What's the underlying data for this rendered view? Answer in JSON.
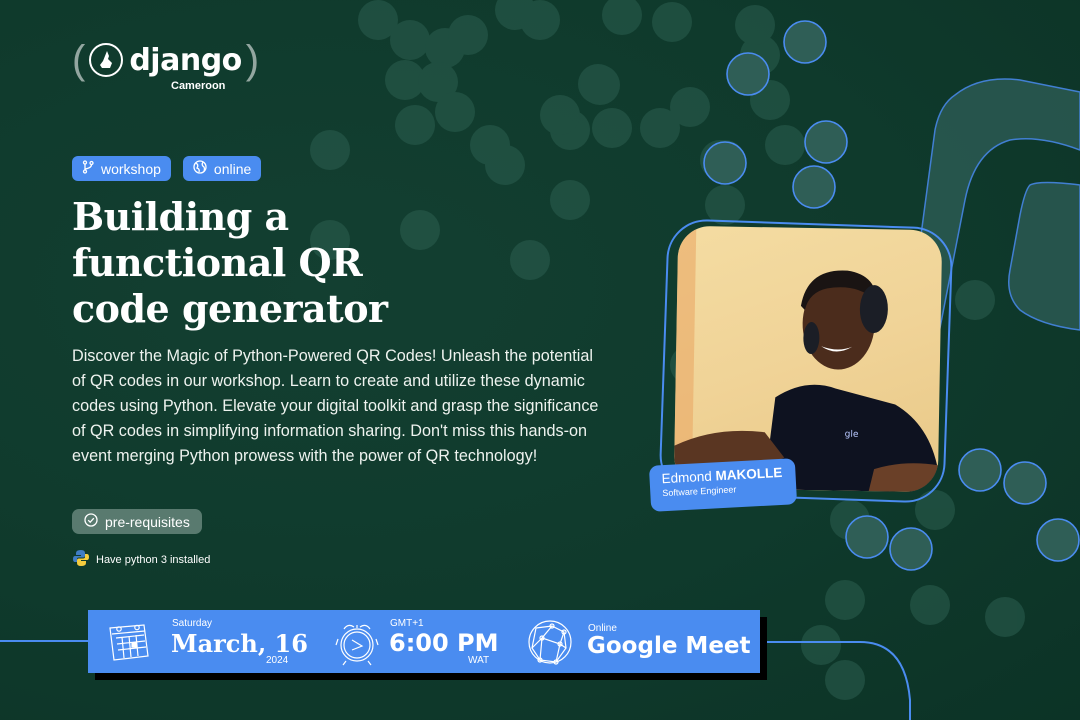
{
  "brand": {
    "logo_word": "django",
    "logo_sub": "Cameroon",
    "logo_icon": "cameroon-map-icon"
  },
  "tags": [
    {
      "label": "workshop",
      "icon": "git-branch-icon"
    },
    {
      "label": "online",
      "icon": "globe-icon"
    }
  ],
  "title_lines": [
    "Building a",
    "functional QR",
    "code generator"
  ],
  "description": "Discover the Magic of Python-Powered QR Codes! Unleash the potential of QR codes in our workshop. Learn to create and utilize these dynamic codes using Python. Elevate your digital toolkit and grasp the significance of QR codes in simplifying information sharing. Don't miss this hands-on event merging Python prowess with the power of QR technology!",
  "prerequisites": {
    "label": "pre-requisites",
    "icon": "check-circle-icon",
    "items": [
      {
        "text": "Have python 3 installed",
        "icon": "python-icon"
      }
    ]
  },
  "speaker": {
    "first_name": "Edmond",
    "last_name": "MAKOLLE",
    "role": "Software Engineer"
  },
  "event_bar": {
    "date": {
      "day": "Saturday",
      "main": "March, 16",
      "year": "2024",
      "icon": "calendar-icon"
    },
    "time": {
      "zone": "GMT+1",
      "main": "6:00 PM",
      "suffix": "WAT",
      "icon": "alarm-clock-icon"
    },
    "venue": {
      "label": "Online",
      "main": "Google Meet",
      "icon": "network-globe-icon"
    }
  },
  "colors": {
    "background": "#0f3a2c",
    "accent": "#4a8cf0",
    "dot_fill": "#2a5a4c"
  }
}
